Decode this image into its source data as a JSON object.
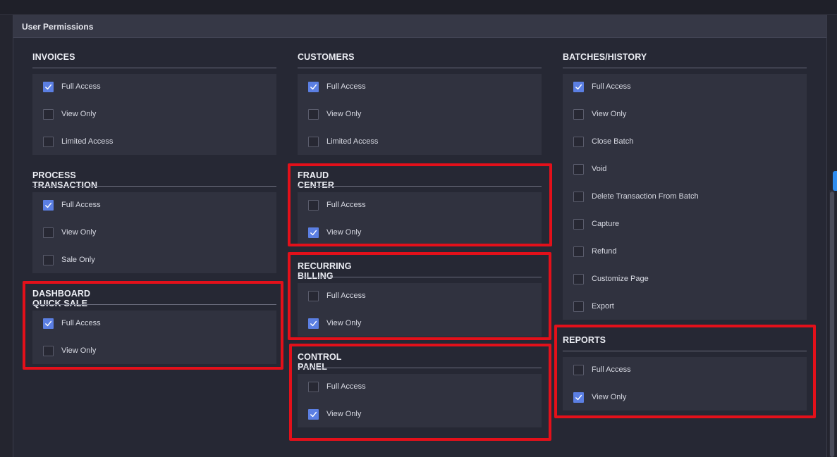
{
  "panel": {
    "title": "User Permissions"
  },
  "colors": {
    "accent": "#5b7fe3",
    "highlight": "#e3101a",
    "background": "#262834",
    "box": "#30323f"
  },
  "sections": {
    "invoices": {
      "title": "INVOICES",
      "options": [
        {
          "label": "Full Access",
          "checked": true
        },
        {
          "label": "View Only",
          "checked": false
        },
        {
          "label": "Limited Access",
          "checked": false
        }
      ]
    },
    "process_transaction": {
      "title": "PROCESS TRANSACTION",
      "options": [
        {
          "label": "Full Access",
          "checked": true
        },
        {
          "label": "View Only",
          "checked": false
        },
        {
          "label": "Sale Only",
          "checked": false
        }
      ]
    },
    "dashboard_quick_sale": {
      "title": "DASHBOARD QUICK SALE",
      "options": [
        {
          "label": "Full Access",
          "checked": true
        },
        {
          "label": "View Only",
          "checked": false
        }
      ]
    },
    "customers": {
      "title": "CUSTOMERS",
      "options": [
        {
          "label": "Full Access",
          "checked": true
        },
        {
          "label": "View Only",
          "checked": false
        },
        {
          "label": "Limited Access",
          "checked": false
        }
      ]
    },
    "fraud_center": {
      "title": "FRAUD CENTER",
      "options": [
        {
          "label": "Full Access",
          "checked": false
        },
        {
          "label": "View Only",
          "checked": true
        }
      ]
    },
    "recurring_billing": {
      "title": "RECURRING BILLING",
      "options": [
        {
          "label": "Full Access",
          "checked": false
        },
        {
          "label": "View Only",
          "checked": true
        }
      ]
    },
    "control_panel": {
      "title": "CONTROL PANEL",
      "options": [
        {
          "label": "Full Access",
          "checked": false
        },
        {
          "label": "View Only",
          "checked": true
        }
      ]
    },
    "batches_history": {
      "title": "BATCHES/HISTORY",
      "options": [
        {
          "label": "Full Access",
          "checked": true
        },
        {
          "label": "View Only",
          "checked": false
        },
        {
          "label": "Close Batch",
          "checked": false
        },
        {
          "label": "Void",
          "checked": false
        },
        {
          "label": "Delete Transaction From Batch",
          "checked": false
        },
        {
          "label": "Capture",
          "checked": false
        },
        {
          "label": "Refund",
          "checked": false
        },
        {
          "label": "Customize Page",
          "checked": false
        },
        {
          "label": "Export",
          "checked": false
        }
      ]
    },
    "reports": {
      "title": "REPORTS",
      "options": [
        {
          "label": "Full Access",
          "checked": false
        },
        {
          "label": "View Only",
          "checked": true
        }
      ]
    }
  }
}
